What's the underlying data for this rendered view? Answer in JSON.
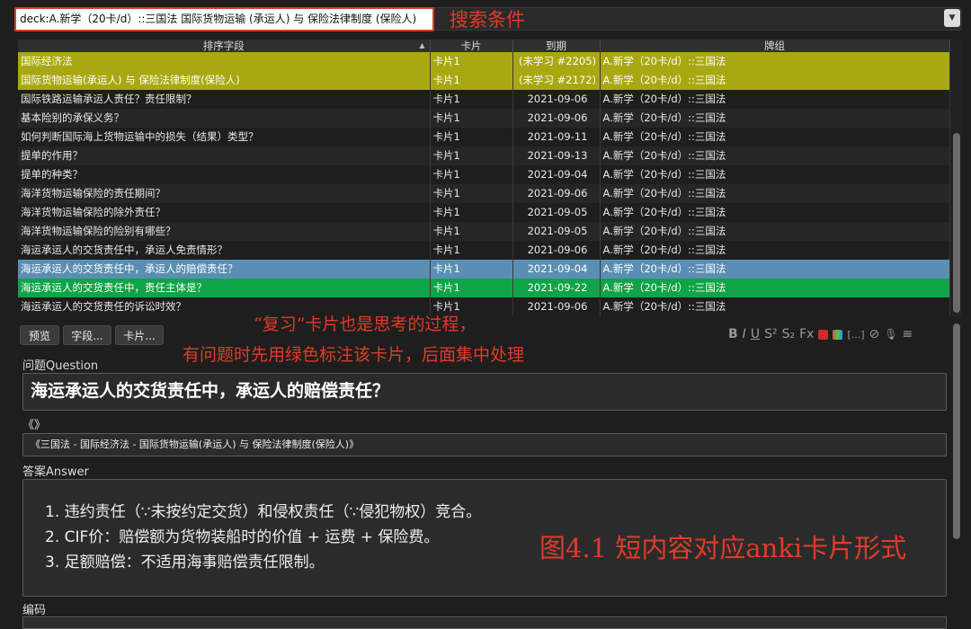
{
  "search": {
    "query": "deck:A.新学（20卡/d）::三国法 国际货物运输 (承运人) 与 保险法律制度 (保险人)",
    "annotation": "搜索条件"
  },
  "table": {
    "columns": [
      "排序字段",
      "卡片",
      "到期",
      "牌组"
    ],
    "rows": [
      {
        "sort": "国际经济法",
        "card": "卡片1",
        "due": "(未学习 #2205)",
        "deck": "A.新学（20卡/d）::三国法",
        "style": "yellow"
      },
      {
        "sort": "国际货物运输(承运人) 与 保险法律制度(保险人)",
        "card": "卡片1",
        "due": "(未学习 #2172)",
        "deck": "A.新学（20卡/d）::三国法",
        "style": "yellow"
      },
      {
        "sort": "国际铁路运输承运人责任？责任限制？",
        "card": "卡片1",
        "due": "2021-09-06",
        "deck": "A.新学（20卡/d）::三国法",
        "style": "odd"
      },
      {
        "sort": "基本险别的承保义务？",
        "card": "卡片1",
        "due": "2021-09-06",
        "deck": "A.新学（20卡/d）::三国法",
        "style": "even"
      },
      {
        "sort": "如何判断国际海上货物运输中的损失（结果）类型？",
        "card": "卡片1",
        "due": "2021-09-11",
        "deck": "A.新学（20卡/d）::三国法",
        "style": "odd"
      },
      {
        "sort": "提单的作用？",
        "card": "卡片1",
        "due": "2021-09-13",
        "deck": "A.新学（20卡/d）::三国法",
        "style": "even"
      },
      {
        "sort": "提单的种类？",
        "card": "卡片1",
        "due": "2021-09-04",
        "deck": "A.新学（20卡/d）::三国法",
        "style": "odd"
      },
      {
        "sort": "海洋货物运输保险的责任期间？",
        "card": "卡片1",
        "due": "2021-09-06",
        "deck": "A.新学（20卡/d）::三国法",
        "style": "even"
      },
      {
        "sort": "海洋货物运输保险的除外责任？",
        "card": "卡片1",
        "due": "2021-09-05",
        "deck": "A.新学（20卡/d）::三国法",
        "style": "odd"
      },
      {
        "sort": "海洋货物运输保险的险别有哪些？",
        "card": "卡片1",
        "due": "2021-09-05",
        "deck": "A.新学（20卡/d）::三国法",
        "style": "even"
      },
      {
        "sort": "海运承运人的交货责任中，承运人免责情形？",
        "card": "卡片1",
        "due": "2021-09-06",
        "deck": "A.新学（20卡/d）::三国法",
        "style": "odd"
      },
      {
        "sort": "海运承运人的交货责任中，承运人的赔偿责任？",
        "card": "卡片1",
        "due": "2021-09-04",
        "deck": "A.新学（20卡/d）::三国法",
        "style": "sel"
      },
      {
        "sort": "海运承运人的交货责任中，责任主体是？",
        "card": "卡片1",
        "due": "2021-09-22",
        "deck": "A.新学（20卡/d）::三国法",
        "style": "green"
      },
      {
        "sort": "海运承运人的交货责任的诉讼时效？",
        "card": "卡片1",
        "due": "2021-09-06",
        "deck": "A.新学（20卡/d）::三国法",
        "style": "odd"
      }
    ]
  },
  "toolbar": {
    "preview": "预览",
    "fields": "字段...",
    "cards": "卡片..."
  },
  "format_icons": [
    "B",
    "I",
    "U",
    "S²",
    "S₂",
    "Fx",
    "[...]",
    "⊘",
    "🎙",
    "≡"
  ],
  "colors": {
    "red": "#e23a2a",
    "selected": "#5a8fb3",
    "green": "#11a347",
    "yellow": "#a9a812"
  },
  "notes": {
    "line1": "“复习”卡片也是思考的过程，",
    "line2": "有问题时先用绿色标注该卡片，后面集中处理"
  },
  "editor": {
    "question_label": "问题Question",
    "question": "海运承运人的交货责任中，承运人的赔偿责任？",
    "ref_label": "《》",
    "ref": "《三国法 - 国际经济法 - 国际货物运输(承运人) 与 保险法律制度(保险人)》",
    "answer_label": "答案Answer",
    "answer": [
      "1. 违约责任（∵未按约定交货）和侵权责任（∵侵犯物权）竞合。",
      "2. CIF价：赔偿额为货物装船时的价值 + 运费 + 保险费。",
      "3. 足额赔偿：不适用海事赔偿责任限制。"
    ],
    "code_label": "编码"
  },
  "caption": "图4.1 短内容对应anki卡片形式"
}
